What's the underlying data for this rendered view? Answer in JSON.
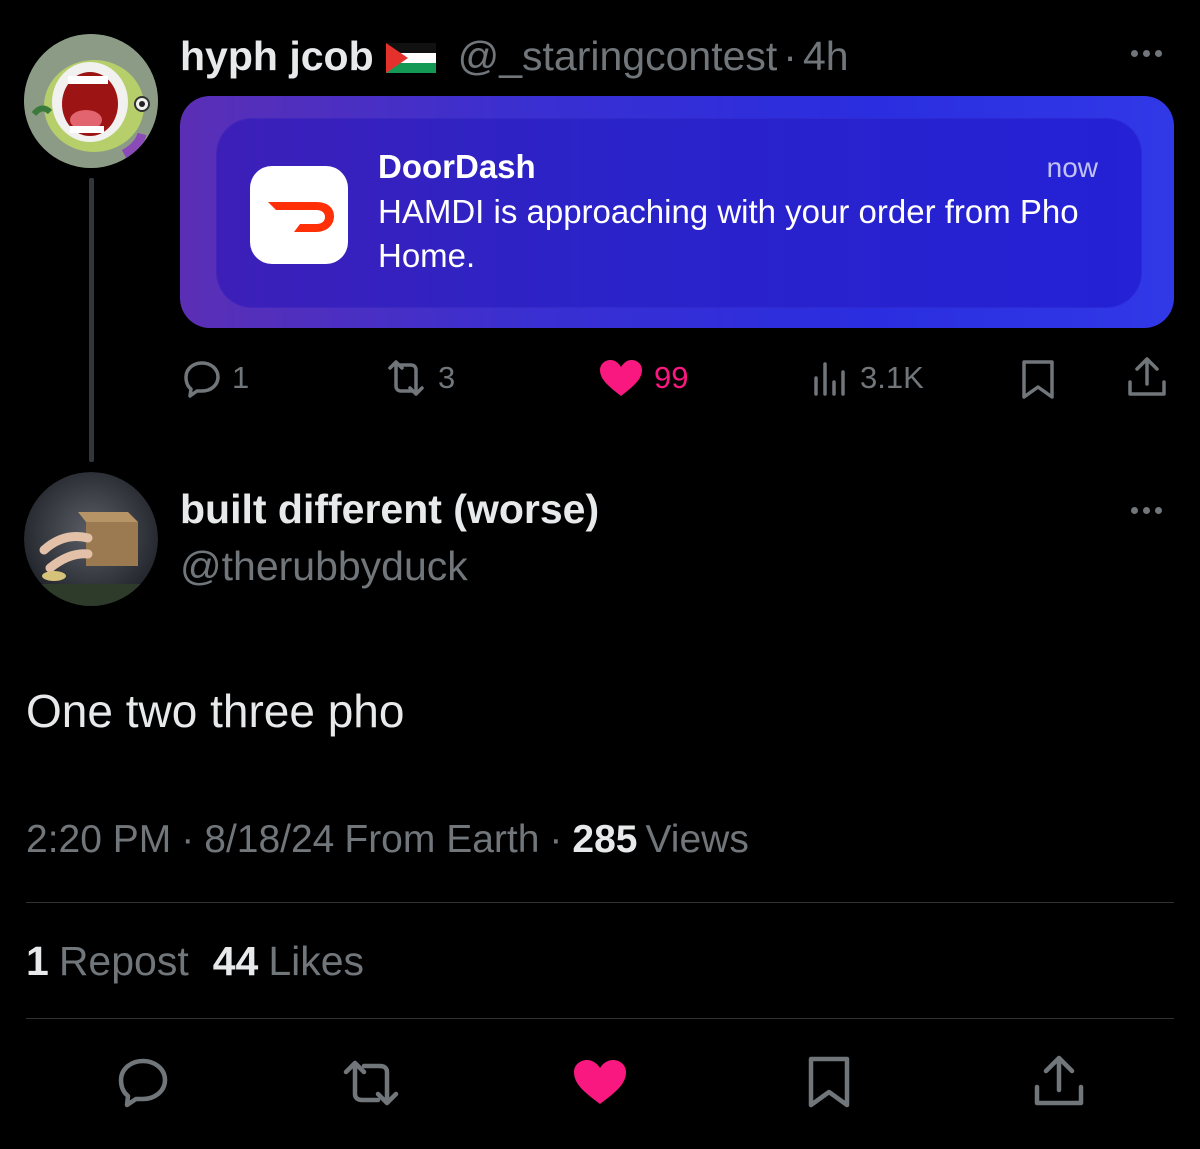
{
  "tweet1": {
    "display_name": "hyph jcob",
    "flag": "🇵🇸",
    "handle": "@_staringcontest",
    "separator": "·",
    "time": "4h",
    "notification": {
      "app": "DoorDash",
      "time": "now",
      "message": "HAMDI is approaching with your order from Pho Home."
    },
    "actions": {
      "replies": "1",
      "reposts": "3",
      "likes": "99",
      "views": "3.1K"
    }
  },
  "tweet2": {
    "display_name": "built different (worse)",
    "handle": "@therubbyduck",
    "text": "One two three pho",
    "meta": {
      "time": "2:20 PM",
      "date": "8/18/24",
      "source": "From Earth",
      "views_count": "285",
      "views_label": "Views"
    },
    "stats": {
      "reposts_count": "1",
      "reposts_label": "Repost",
      "likes_count": "44",
      "likes_label": "Likes"
    }
  },
  "colors": {
    "like_pink": "#f91880",
    "muted_gray": "#71767b",
    "text": "#e7e9ea",
    "doordash_red": "#ff3008"
  }
}
